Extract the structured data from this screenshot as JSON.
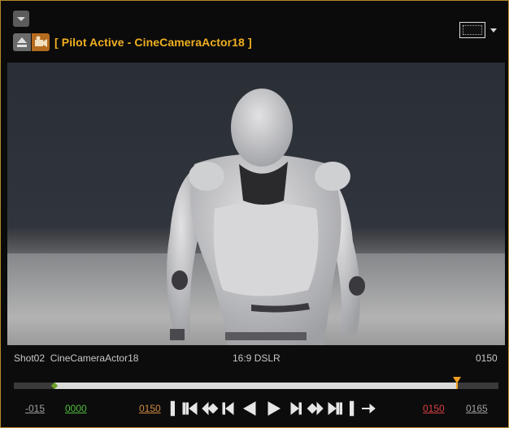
{
  "viewport_title": "[ Pilot Active - CineCameraActor18 ]",
  "info": {
    "shot": "Shot02",
    "camera": "CineCameraActor18",
    "aspect": "16:9 DSLR",
    "end_frame": "0150"
  },
  "timeline": {
    "view_start": "-015",
    "playback_start": "0000",
    "current_frame": "0150",
    "playback_end": "0150",
    "view_end": "0165"
  },
  "icons": {
    "menu": "chevron-down-icon",
    "eject": "eject-icon",
    "pilot": "camera-pilot-icon",
    "layout": "viewport-layout-icon"
  },
  "colors": {
    "accent": "#f0b020",
    "playback_start": "#4fbf3c",
    "playback_end": "#d84040",
    "current_frame": "#d08a3c",
    "border": "#b58a2a"
  }
}
